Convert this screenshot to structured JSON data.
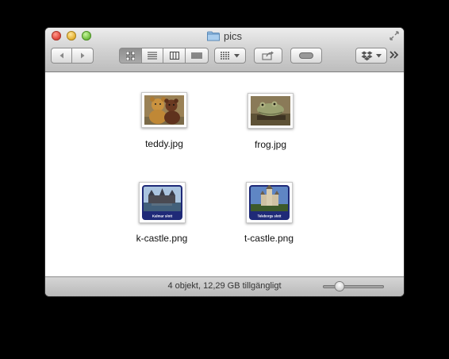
{
  "window": {
    "title": "pics",
    "title_icon": "folder-icon"
  },
  "toolbar": {
    "nav": [
      "back-arrow-icon",
      "forward-arrow-icon"
    ],
    "view_modes": [
      {
        "name": "icon-view",
        "icon": "grid-icon",
        "active": true
      },
      {
        "name": "list-view",
        "icon": "list-icon",
        "active": false
      },
      {
        "name": "column-view",
        "icon": "columns-icon",
        "active": false
      },
      {
        "name": "coverflow-view",
        "icon": "coverflow-icon",
        "active": false
      }
    ],
    "arrange_icon": "arrange-grid-icon",
    "share_icon": "share-icon",
    "tag_icon": "label-pill-icon",
    "dropbox_icon": "dropbox-icon",
    "overflow_icon": "double-chevron-icon"
  },
  "files": [
    {
      "name": "teddy.jpg",
      "thumb": "teddy bears photo"
    },
    {
      "name": "frog.jpg",
      "thumb": "frog photo"
    },
    {
      "name": "k-castle.png",
      "caption": "Kalmar slott"
    },
    {
      "name": "t-castle.png",
      "caption": "Teleborgs slott"
    }
  ],
  "status": {
    "text": "4 objekt, 12,29 GB tillgängligt",
    "zoom_level": 0.27
  },
  "colors": {
    "close": "#e0443b",
    "minimize": "#e5b132",
    "zoom": "#71be3f",
    "castle_caption_bg": "#1f2a78"
  }
}
